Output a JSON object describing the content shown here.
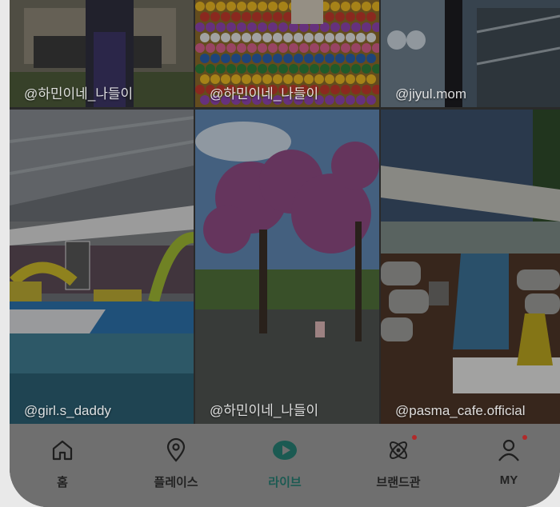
{
  "feed": {
    "tiles": [
      {
        "handle": "@하민이네_나들이"
      },
      {
        "handle": "@하민이네_나들이"
      },
      {
        "handle": "@jiyul.mom"
      },
      {
        "handle": "@girl.s_daddy"
      },
      {
        "handle": "@하민이네_나들이"
      },
      {
        "handle": "@pasma_cafe.official"
      }
    ]
  },
  "nav": {
    "items": [
      {
        "label": "홈",
        "icon": "home-icon"
      },
      {
        "label": "플레이스",
        "icon": "location-pin-icon"
      },
      {
        "label": "라이브",
        "icon": "play-icon"
      },
      {
        "label": "브랜드관",
        "icon": "atom-icon"
      },
      {
        "label": "MY",
        "icon": "person-icon"
      }
    ],
    "active": "라이브"
  },
  "colors": {
    "active_tab": "#1b5a52",
    "badge": "#b12a2a",
    "nav_bg": "#6f6f6f"
  }
}
